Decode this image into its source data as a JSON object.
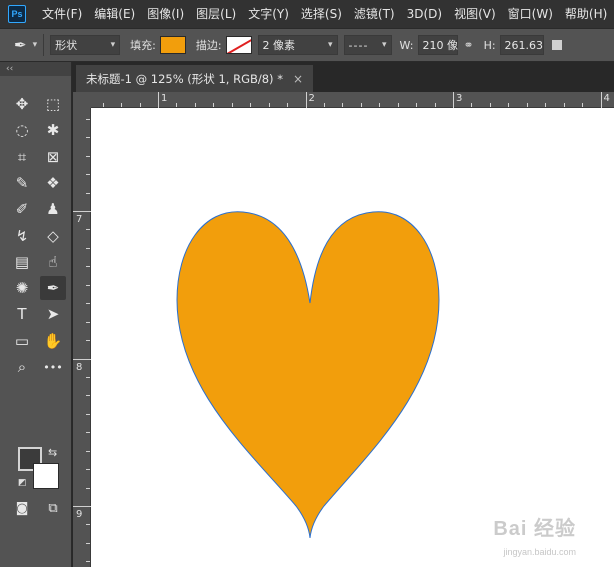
{
  "app": {
    "logo_text": "Ps"
  },
  "menu": [
    "文件(F)",
    "编辑(E)",
    "图像(I)",
    "图层(L)",
    "文字(Y)",
    "选择(S)",
    "滤镜(T)",
    "3D(D)",
    "视图(V)",
    "窗口(W)",
    "帮助(H)"
  ],
  "options": {
    "mode_value": "形状",
    "fill_label": "填充:",
    "fill_color": "#f29e0c",
    "stroke_label": "描边:",
    "stroke_width_value": "2 像素",
    "w_label": "W:",
    "w_value": "210 像",
    "h_label": "H:",
    "h_value": "261.63"
  },
  "document": {
    "tab_title": "未标题-1 @ 125% (形状 1, RGB/8) *",
    "close_glyph": "×"
  },
  "rulers": {
    "horizontal_labels": [
      "1",
      "2",
      "3",
      "4"
    ],
    "vertical_labels": [
      "7",
      "8",
      "9"
    ]
  },
  "toolbar": {
    "collapse_glyph": "‹‹",
    "tools": [
      {
        "name": "move-tool",
        "glyph": "✥"
      },
      {
        "name": "marquee-tool",
        "glyph": "⬚"
      },
      {
        "name": "lasso-tool",
        "glyph": "◌"
      },
      {
        "name": "quick-select-tool",
        "glyph": "✱"
      },
      {
        "name": "crop-tool",
        "glyph": "⌗"
      },
      {
        "name": "frame-tool",
        "glyph": "⊠"
      },
      {
        "name": "eyedropper-tool",
        "glyph": "✎"
      },
      {
        "name": "spot-heal-tool",
        "glyph": "❖"
      },
      {
        "name": "brush-tool",
        "glyph": "✐"
      },
      {
        "name": "stamp-tool",
        "glyph": "♟"
      },
      {
        "name": "history-brush-tool",
        "glyph": "↯"
      },
      {
        "name": "eraser-tool",
        "glyph": "◇"
      },
      {
        "name": "gradient-tool",
        "glyph": "▤"
      },
      {
        "name": "smudge-tool",
        "glyph": "☝"
      },
      {
        "name": "dodge-tool",
        "glyph": "✺"
      },
      {
        "name": "pen-tool",
        "glyph": "✒"
      },
      {
        "name": "type-tool",
        "glyph": "T"
      },
      {
        "name": "path-select-tool",
        "glyph": "➤"
      },
      {
        "name": "rectangle-tool",
        "glyph": "▭"
      },
      {
        "name": "hand-tool",
        "glyph": "✋"
      },
      {
        "name": "zoom-tool",
        "glyph": "⌕"
      },
      {
        "name": "more-tools",
        "glyph": "•••"
      },
      {
        "name": "quick-mask",
        "glyph": "◙"
      },
      {
        "name": "screen-mode",
        "glyph": "⧉"
      }
    ]
  },
  "shape": {
    "fill_color": "#f29e0c",
    "stroke_color": "#2a6fcf"
  },
  "watermark": {
    "brand": "Bai 经验",
    "url": "jingyan.baidu.com"
  }
}
